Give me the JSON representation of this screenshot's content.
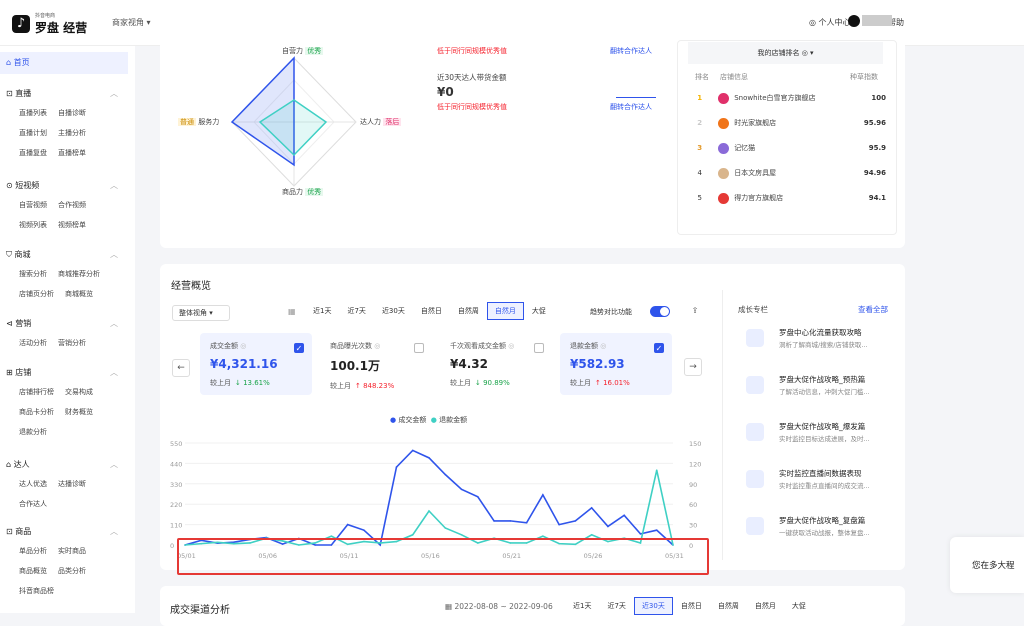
{
  "header": {
    "logo_small": "抖音电商",
    "logo_big": "罗盘 经营",
    "perspective": "商家视角",
    "perspective_arrow": "▾",
    "personal": "个人中心",
    "help": "帮助"
  },
  "sidebar": {
    "home": "首页",
    "sections": [
      {
        "title": "直播",
        "items": [
          [
            "直播列表",
            "自播诊断"
          ],
          [
            "直播计划",
            "主播分析"
          ],
          [
            "直播复盘",
            "直播榜单"
          ]
        ]
      },
      {
        "title": "短视频",
        "items": [
          [
            "自营视频",
            "合作视频"
          ],
          [
            "视频列表",
            "视频榜单"
          ]
        ]
      },
      {
        "title": "商城",
        "items": [
          [
            "搜索分析",
            "商城推荐分析"
          ],
          [
            "店铺页分析",
            "商城概览"
          ]
        ]
      },
      {
        "title": "营销",
        "items": [
          [
            "活动分析",
            "营销分析"
          ]
        ]
      },
      {
        "title": "店铺",
        "items": [
          [
            "店铺排行榜",
            "交易构成"
          ],
          [
            "商品卡分析",
            "财务概览"
          ],
          [
            "退款分析"
          ]
        ]
      },
      {
        "title": "达人",
        "items": [
          [
            "达人优选",
            "达播诊断"
          ],
          [
            "合作达人"
          ]
        ]
      },
      {
        "title": "商品",
        "items": [
          [
            "单品分析",
            "实时商品"
          ],
          [
            "商品概览",
            "品类分析"
          ],
          [
            "抖音商品榜"
          ]
        ]
      }
    ]
  },
  "radar": {
    "top": "自营力",
    "top_tag": "优秀",
    "left": "服务力",
    "left_tag": "普通",
    "right": "达人力",
    "right_tag": "落后",
    "bottom": "商品力",
    "bottom_tag": "优秀"
  },
  "mid": {
    "row1_low": "低于同行同规模优秀值",
    "row1_link": "翻转合作达人",
    "label": "近30天达人带货金额",
    "value": "¥0",
    "row2_low": "低于同行同规模优秀值",
    "row2_link": "翻转合作达人"
  },
  "ranking": {
    "my_rank": "我的店铺排名",
    "headers": [
      "排名",
      "店铺信息",
      "种草指数"
    ],
    "rows": [
      {
        "rank": "1",
        "name": "Snowhite白雪官方旗舰店",
        "score": "100"
      },
      {
        "rank": "2",
        "name": "时光家旗舰店",
        "score": "95.96"
      },
      {
        "rank": "3",
        "name": "记忆猫",
        "score": "95.9"
      },
      {
        "rank": "4",
        "name": "日本文房具屋",
        "score": "94.96"
      },
      {
        "rank": "5",
        "name": "得力官方旗舰店",
        "score": "94.1"
      }
    ]
  },
  "overview": {
    "title": "经营概览",
    "view": "整体视角",
    "tabs": [
      "近1天",
      "近7天",
      "近30天",
      "自然日",
      "自然周",
      "自然月",
      "大促"
    ],
    "active_tab": 5,
    "trend_label": "趋势对比功能",
    "metrics": [
      {
        "label": "成交金额",
        "value": "¥4,321.16",
        "cmp": "较上月",
        "chg": "↓ 13.61%",
        "dir": "dn",
        "checked": true
      },
      {
        "label": "商品曝光次数",
        "value": "100.1万",
        "cmp": "较上月",
        "chg": "↑ 848.23%",
        "dir": "up",
        "checked": false
      },
      {
        "label": "千次观看成交金额",
        "value": "¥4.32",
        "cmp": "较上月",
        "chg": "↓ 90.89%",
        "dir": "dn",
        "checked": false
      },
      {
        "label": "退款金额",
        "value": "¥582.93",
        "cmp": "较上月",
        "chg": "↑ 16.01%",
        "dir": "up",
        "checked": true
      }
    ]
  },
  "growth": {
    "title": "成长专栏",
    "more": "查看全部",
    "items": [
      {
        "t": "罗盘中心化流量获取攻略",
        "d": "洞析了解商城/搜索/店铺获取..."
      },
      {
        "t": "罗盘大促作战攻略_预热篇",
        "d": "了解活动信息，冲刺大促门槛..."
      },
      {
        "t": "罗盘大促作战攻略_爆发篇",
        "d": "实时监控目标达成进展，及时..."
      },
      {
        "t": "实时监控直播间数据表现",
        "d": "实时监控重点直播间的成交流..."
      },
      {
        "t": "罗盘大促作战攻略_复盘篇",
        "d": "一键获取活动战报，整体复盘..."
      }
    ]
  },
  "channel": {
    "title": "成交渠道分析",
    "date": "2022-08-08 ~ 2022-09-06",
    "tabs": [
      "近1天",
      "近7天",
      "近30天",
      "自然日",
      "自然周",
      "自然月",
      "大促"
    ],
    "active": 2
  },
  "floating": "您在多大程",
  "chart_data": {
    "type": "line",
    "x": [
      "05/01",
      "05/02",
      "05/03",
      "05/04",
      "05/05",
      "05/06",
      "05/07",
      "05/08",
      "05/09",
      "05/10",
      "05/11",
      "05/12",
      "05/13",
      "05/14",
      "05/15",
      "05/16",
      "05/17",
      "05/18",
      "05/19",
      "05/20",
      "05/21",
      "05/22",
      "05/23",
      "05/24",
      "05/25",
      "05/26",
      "05/27",
      "05/28",
      "05/29",
      "05/30",
      "05/31"
    ],
    "xticks": [
      "05/01",
      "05/06",
      "05/11",
      "05/16",
      "05/21",
      "05/26",
      "05/31"
    ],
    "y_left": [
      0,
      110,
      220,
      330,
      440,
      550
    ],
    "y_right": [
      0,
      30,
      60,
      90,
      120,
      150
    ],
    "series": [
      {
        "name": "成交金额",
        "axis": "left",
        "color": "#2f54eb",
        "values": [
          0,
          25,
          10,
          15,
          30,
          40,
          5,
          35,
          0,
          0,
          110,
          80,
          0,
          420,
          510,
          470,
          380,
          300,
          260,
          130,
          130,
          120,
          270,
          110,
          130,
          200,
          100,
          160,
          60,
          80,
          0
        ]
      },
      {
        "name": "退款金额",
        "axis": "right",
        "color": "#3fd0c4",
        "values": [
          0,
          2,
          4,
          2,
          3,
          10,
          6,
          0,
          3,
          13,
          1,
          5,
          3,
          5,
          15,
          50,
          25,
          15,
          3,
          10,
          3,
          3,
          13,
          2,
          1,
          15,
          5,
          10,
          3,
          110,
          0
        ]
      }
    ]
  }
}
